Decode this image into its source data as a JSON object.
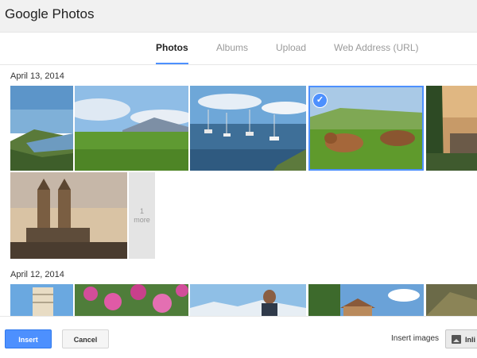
{
  "window": {
    "title": "Google Photos"
  },
  "tabs": [
    {
      "label": "Photos",
      "active": true
    },
    {
      "label": "Albums",
      "active": false
    },
    {
      "label": "Upload",
      "active": false
    },
    {
      "label": "Web Address (URL)",
      "active": false
    }
  ],
  "groups": [
    {
      "date": "April 13, 2014",
      "photos": [
        {
          "subject": "lake-valley"
        },
        {
          "subject": "meadow-mountains"
        },
        {
          "subject": "harbor-sailboats"
        },
        {
          "subject": "cows-on-meadow",
          "selected": true
        },
        {
          "subject": "village-sunset"
        },
        {
          "subject": "cathedral-towers"
        }
      ],
      "more_tile": {
        "count": "1",
        "label": "more"
      }
    },
    {
      "date": "April 12, 2014",
      "photos": [
        {
          "subject": "leaning-tower"
        },
        {
          "subject": "pink-flowers"
        },
        {
          "subject": "person-mountains"
        },
        {
          "subject": "house-trees"
        },
        {
          "subject": "rocky-path"
        }
      ]
    }
  ],
  "footer": {
    "insert_label": "Insert",
    "cancel_label": "Cancel",
    "insert_images_label": "Insert images",
    "inline_label": "Inli"
  },
  "colors": {
    "accent": "#4d90fe",
    "titlebar_bg": "#f1f1f1"
  }
}
